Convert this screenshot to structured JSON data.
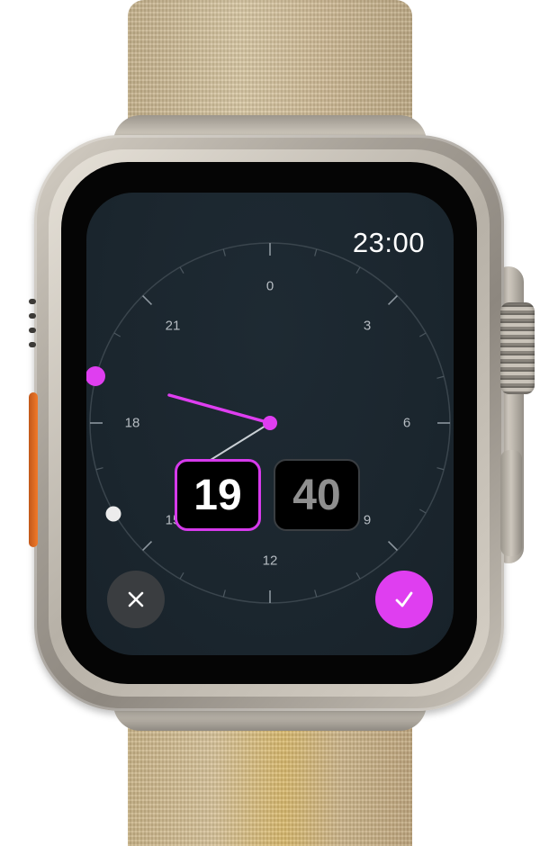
{
  "app": {
    "time_readout": "23:00"
  },
  "dial": {
    "hour_labels": [
      "0",
      "3",
      "6",
      "9",
      "12",
      "15",
      "18",
      "21"
    ],
    "selected_hour_handle_color": "#df3ef0",
    "end_handle_color": "#ececec"
  },
  "picker": {
    "hours_value": "19",
    "minutes_value": "40",
    "active_field": "hours"
  },
  "actions": {
    "cancel_icon": "close-icon",
    "confirm_icon": "checkmark-icon"
  },
  "colors": {
    "accent": "#df3ef0",
    "screen_background": "#1b262e",
    "text_primary": "#ffffff",
    "text_secondary": "#b6bcc2",
    "action_button": "#f07a2a"
  }
}
